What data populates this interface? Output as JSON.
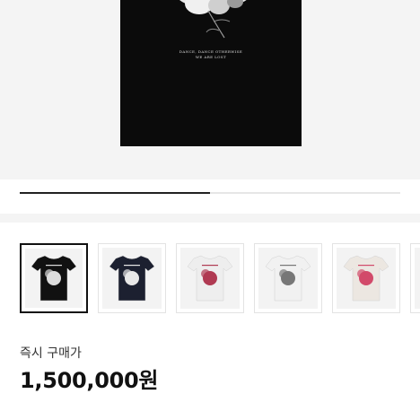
{
  "hero": {
    "print_line_1": "DANCE, DANCE OTHERWISE",
    "print_line_2": "WE ARE LOST",
    "active_image_fraction": 0.5
  },
  "thumbnails": [
    {
      "shirt_color": "#111111",
      "print_color": "#dddddd",
      "selected": true
    },
    {
      "shirt_color": "#1c2030",
      "print_color": "#e8e8e8",
      "selected": false
    },
    {
      "shirt_color": "#eeeeee",
      "print_color": "#b03a52",
      "selected": false
    },
    {
      "shirt_color": "#f1f1f1",
      "print_color": "#777777",
      "selected": false
    },
    {
      "shirt_color": "#ece7e1",
      "print_color": "#d24a6a",
      "selected": false
    },
    {
      "shirt_color": "#eeeeee",
      "print_color": "#555555",
      "selected": false
    }
  ],
  "price": {
    "label": "즉시 구매가",
    "value": "1,500,000원"
  },
  "colors": {
    "accent": "#111111",
    "track": "#e6e6e6"
  }
}
